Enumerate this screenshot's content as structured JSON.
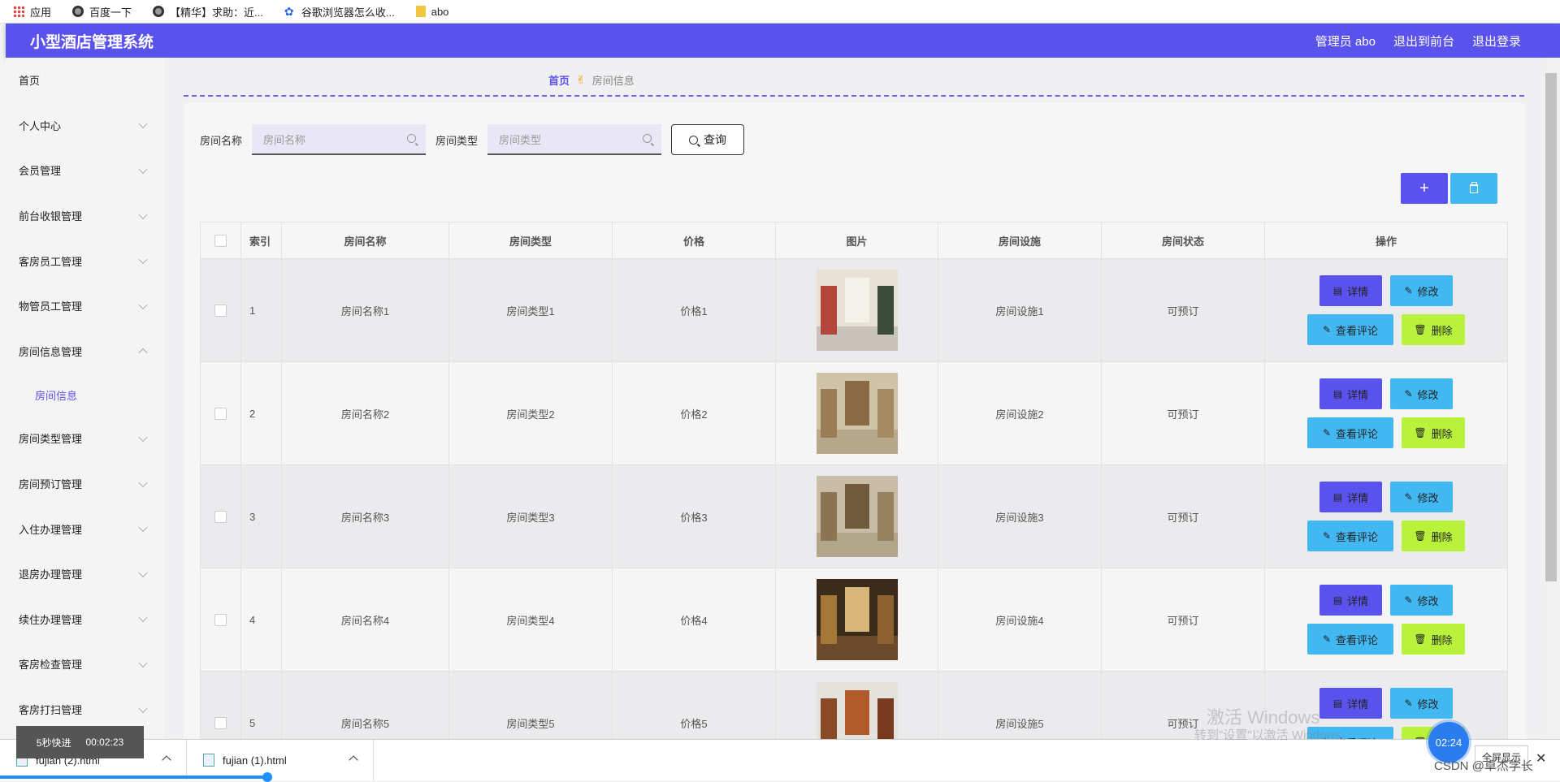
{
  "bookmarks": [
    {
      "label": "应用",
      "icon": "apps-icon"
    },
    {
      "label": "百度一下",
      "icon": "globe-icon"
    },
    {
      "label": "【精华】求助：近...",
      "icon": "globe-icon"
    },
    {
      "label": "谷歌浏览器怎么收...",
      "icon": "paw-icon"
    },
    {
      "label": "abo",
      "icon": "folder-icon"
    }
  ],
  "header": {
    "title": "小型酒店管理系统",
    "admin": "管理员 abo",
    "to_front": "退出到前台",
    "logout": "退出登录"
  },
  "sidebar": {
    "items": [
      {
        "label": "首页"
      },
      {
        "label": "个人中心"
      },
      {
        "label": "会员管理"
      },
      {
        "label": "前台收银管理"
      },
      {
        "label": "客房员工管理"
      },
      {
        "label": "物管员工管理"
      },
      {
        "label": "房间信息管理"
      },
      {
        "label": "房间类型管理"
      },
      {
        "label": "房间预订管理"
      },
      {
        "label": "入住办理管理"
      },
      {
        "label": "退房办理管理"
      },
      {
        "label": "续住办理管理"
      },
      {
        "label": "客房检查管理"
      },
      {
        "label": "客房打扫管理"
      }
    ],
    "sub_item": "房间信息"
  },
  "breadcrumb": {
    "home": "首页",
    "current": "房间信息"
  },
  "search": {
    "name_label": "房间名称",
    "name_placeholder": "房间名称",
    "type_label": "房间类型",
    "type_placeholder": "房间类型",
    "query_button": "查询"
  },
  "toolbar": {
    "add": "+"
  },
  "table": {
    "headers": [
      "索引",
      "房间名称",
      "房间类型",
      "价格",
      "图片",
      "房间设施",
      "房间状态",
      "操作"
    ],
    "rows": [
      {
        "index": "1",
        "name": "房间名称1",
        "type": "房间类型1",
        "price": "价格1",
        "facilities": "房间设施1",
        "status": "可预订"
      },
      {
        "index": "2",
        "name": "房间名称2",
        "type": "房间类型2",
        "price": "价格2",
        "facilities": "房间设施2",
        "status": "可预订"
      },
      {
        "index": "3",
        "name": "房间名称3",
        "type": "房间类型3",
        "price": "价格3",
        "facilities": "房间设施3",
        "status": "可预订"
      },
      {
        "index": "4",
        "name": "房间名称4",
        "type": "房间类型4",
        "price": "价格4",
        "facilities": "房间设施4",
        "status": "可预订"
      },
      {
        "index": "5",
        "name": "房间名称5",
        "type": "房间类型5",
        "price": "价格5",
        "facilities": "房间设施5",
        "status": "可预订"
      }
    ],
    "actions": {
      "detail": "详情",
      "edit": "修改",
      "review": "查看评论",
      "delete": "删除"
    }
  },
  "downloads": [
    {
      "label": "fujian (2).html"
    },
    {
      "label": "fujian (1).html"
    }
  ],
  "video_overlay": {
    "speed": "5秒快进",
    "time": "00:02:23",
    "timer": "02:24",
    "fullscreen": "全屏显示"
  },
  "watermark": {
    "line1": "激活 Windows",
    "line2": "转到\"设置\"以激活 Windows。"
  },
  "csdn": "CSDN @卓杰学长",
  "colors": {
    "primary": "#5a52ec",
    "info": "#42b8f2",
    "success": "#b9f23a"
  }
}
